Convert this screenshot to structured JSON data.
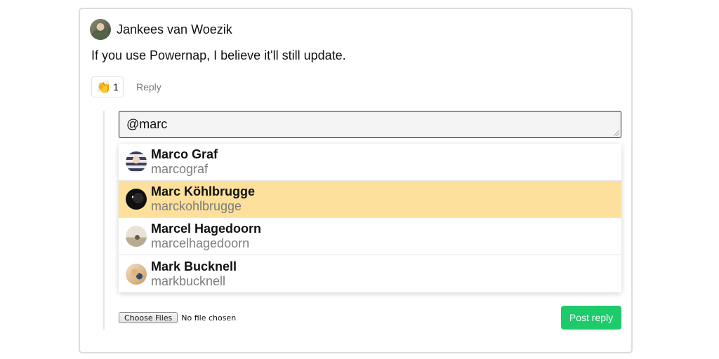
{
  "comment": {
    "author": "Jankees van Woezik",
    "text": "If you use Powernap, I believe it'll still update.",
    "reaction": {
      "emoji": "👏",
      "count": "1"
    },
    "reply_label": "Reply"
  },
  "reply_box": {
    "input_value": "@marc"
  },
  "mentions": [
    {
      "name": "Marco Graf",
      "handle": "marcograf",
      "selected": false
    },
    {
      "name": "Marc Köhlbrugge",
      "handle": "marckohlbrugge",
      "selected": true
    },
    {
      "name": "Marcel Hagedoorn",
      "handle": "marcelhagedoorn",
      "selected": false
    },
    {
      "name": "Mark Bucknell",
      "handle": "markbucknell",
      "selected": false
    }
  ],
  "attachments": {
    "choose_label": "Choose Files",
    "status": "No file chosen"
  },
  "post_reply_label": "Post reply",
  "colors": {
    "selected_highlight": "#fde09c",
    "post_button": "#1ecb6b",
    "handle_text": "#7d7d7d"
  }
}
